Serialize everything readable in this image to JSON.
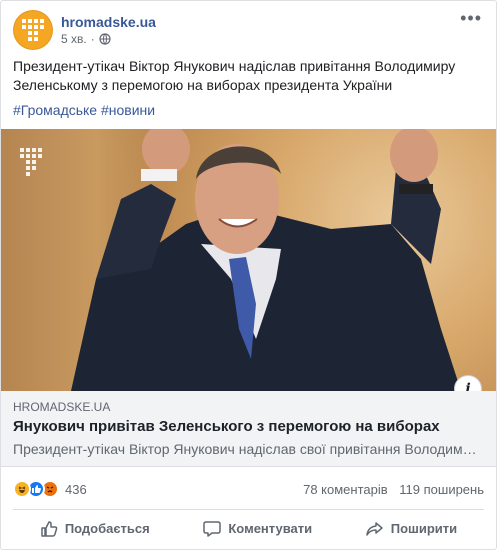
{
  "post": {
    "page_name": "hromadske.ua",
    "time": "5 хв.",
    "privacy_icon": "globe-icon",
    "text": "Президент-утікач Віктор Янукович надіслав привітання Володимиру Зеленському з перемогою на виборах президента України",
    "hashtags": "#Громадське #новини"
  },
  "link": {
    "domain": "HROMADSKE.UA",
    "title": "Янукович привітав Зеленського з перемогою на виборах",
    "description": "Президент-утікач Віктор Янукович надіслав свої привітання Володимиру Зеленському з перемогою на виборах президента України"
  },
  "stats": {
    "reaction_count": "436",
    "comments": "78 коментарів",
    "shares": "119 поширень"
  },
  "actions": {
    "like": "Подобається",
    "comment": "Коментувати",
    "share": "Поширити"
  },
  "colors": {
    "brand_orange": "#f5a623",
    "link_blue": "#385898",
    "like_blue": "#1877f2"
  }
}
